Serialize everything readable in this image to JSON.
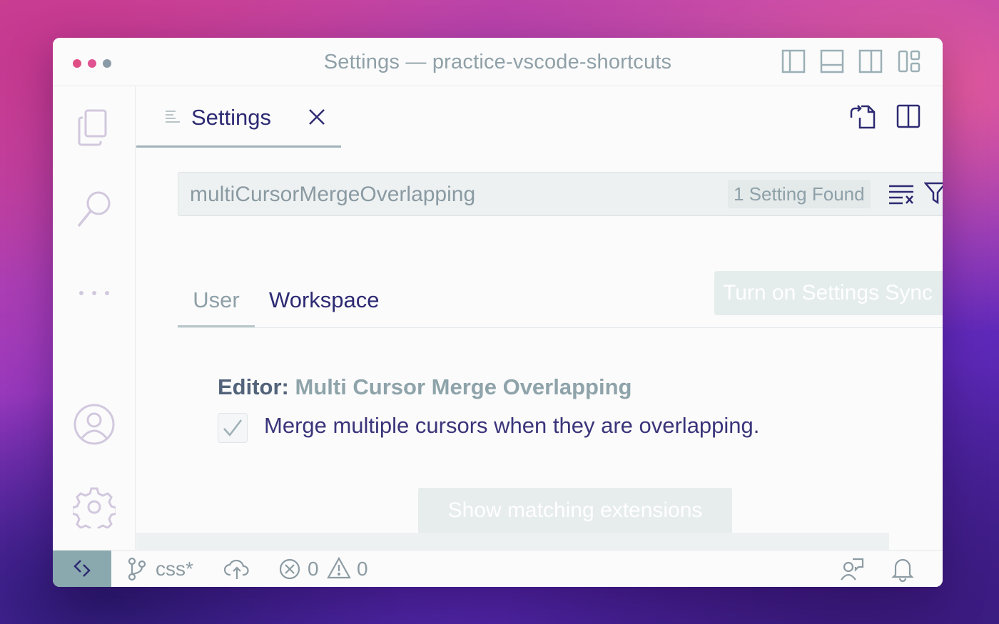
{
  "window": {
    "title": "Settings — practice-vscode-shortcuts"
  },
  "titlebar": {
    "layout_icons": [
      "toggle-primary-sidebar-icon",
      "toggle-panel-icon",
      "toggle-secondary-sidebar-icon",
      "customize-layout-icon"
    ]
  },
  "activity_bar": {
    "items": [
      "explorer-icon",
      "search-icon",
      "more-icon",
      "accounts-icon",
      "manage-gear-icon"
    ]
  },
  "tab": {
    "label": "Settings",
    "icon": "settings-list-icon"
  },
  "tab_actions": [
    "open-settings-json-icon",
    "split-editor-icon"
  ],
  "search": {
    "value": "multiCursorMergeOverlapping",
    "results_badge": "1 Setting Found"
  },
  "scope_tabs": {
    "user": "User",
    "workspace": "Workspace"
  },
  "sync_button": "Turn on Settings Sync",
  "setting": {
    "category": "Editor: ",
    "name": "Multi Cursor Merge Overlapping",
    "description": "Merge multiple cursors when they are overlapping.",
    "checked": true
  },
  "extensions_button": "Show matching extensions",
  "statusbar": {
    "branch": "css*",
    "errors": "0",
    "warnings": "0"
  },
  "colors": {
    "accent": "#2d2a73",
    "muted": "#8ea0a8",
    "remote": "#8aa9ae"
  }
}
